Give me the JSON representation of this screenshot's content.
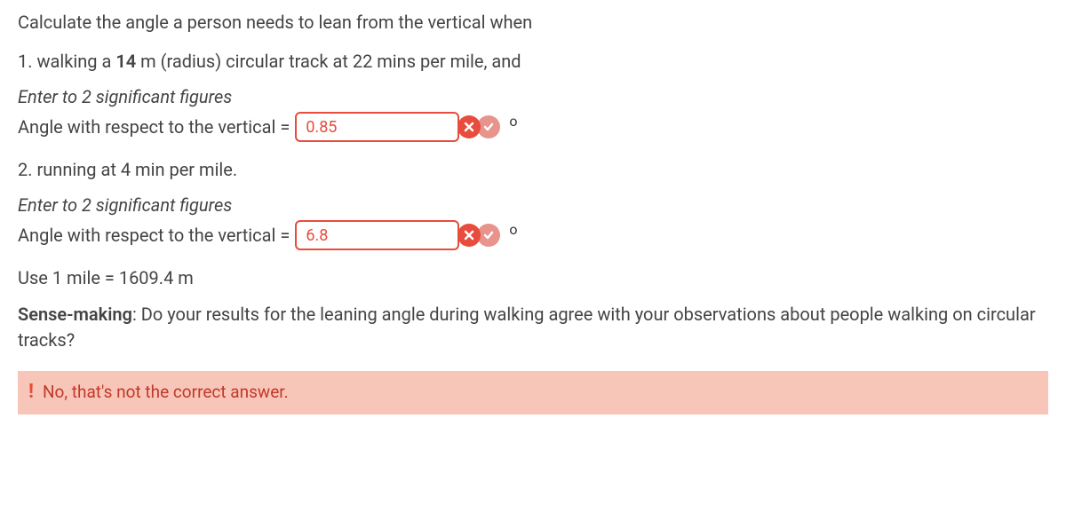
{
  "question": {
    "intro": "Calculate the angle a person needs to lean from the vertical when",
    "part1": {
      "prefix": "1. walking a ",
      "radius": "14",
      "suffix": " m (radius) circular track at 22 mins per mile, and"
    },
    "instruction": "Enter to 2 significant figures",
    "answer1": {
      "label": "Angle with respect to the vertical = ",
      "value": "0.85",
      "unit": "o"
    },
    "part2": "2. running at 4 min per mile.",
    "answer2": {
      "label": "Angle with respect to the vertical = ",
      "value": "6.8",
      "unit": "o"
    },
    "note": "Use 1 mile = 1609.4 m",
    "sense_making": {
      "label": "Sense-making",
      "text": ": Do your results for the leaning angle during walking agree with your observations about people walking on circular tracks?"
    }
  },
  "feedback": {
    "text": "No, that's not the correct answer."
  }
}
